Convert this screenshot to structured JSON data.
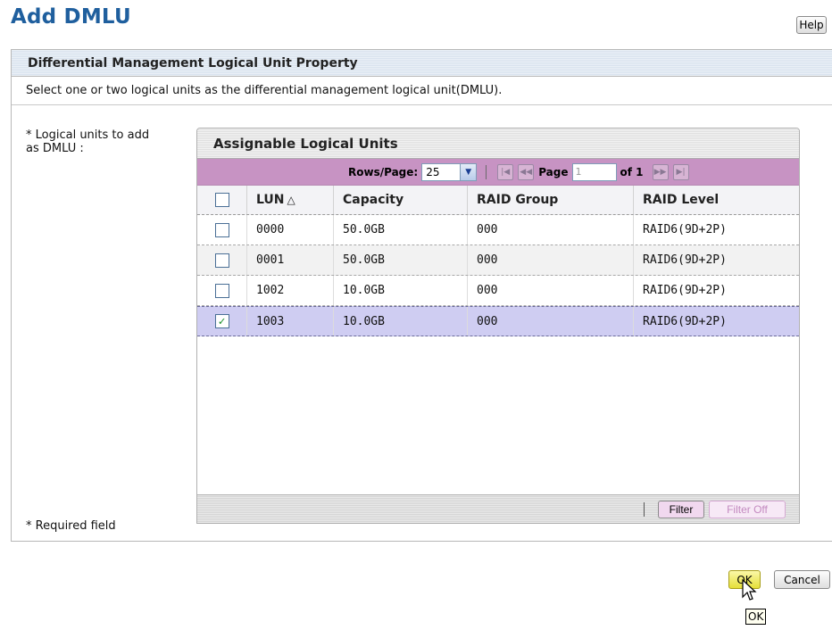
{
  "page": {
    "title": "Add DMLU",
    "help_label": "Help"
  },
  "panel": {
    "title": "Differential Management Logical Unit Property",
    "instructions": "Select one or two logical units as the differential management logical unit(DMLU).",
    "field_label_line1": "* Logical units to add",
    "field_label_line2": "as DMLU :",
    "required_note": "* Required field"
  },
  "grid": {
    "title": "Assignable Logical Units",
    "pager": {
      "rows_per_page_label": "Rows/Page:",
      "rows_per_page_value": "25",
      "page_label": "Page",
      "page_input_value": "1",
      "of_label": "of 1"
    },
    "columns": {
      "lun": "LUN",
      "lun_sort_glyph": "△",
      "capacity": "Capacity",
      "raid_group": "RAID Group",
      "raid_level": "RAID Level"
    },
    "rows": [
      {
        "lun": "0000",
        "capacity": "50.0GB",
        "raid_group": "000",
        "raid_level": "RAID6(9D+2P)",
        "checked": false
      },
      {
        "lun": "0001",
        "capacity": "50.0GB",
        "raid_group": "000",
        "raid_level": "RAID6(9D+2P)",
        "checked": false
      },
      {
        "lun": "1002",
        "capacity": "10.0GB",
        "raid_group": "000",
        "raid_level": "RAID6(9D+2P)",
        "checked": false
      },
      {
        "lun": "1003",
        "capacity": "10.0GB",
        "raid_group": "000",
        "raid_level": "RAID6(9D+2P)",
        "checked": true
      }
    ],
    "filter_label": "Filter",
    "filter_off_label": "Filter Off"
  },
  "actions": {
    "ok_label": "OK",
    "cancel_label": "Cancel",
    "tooltip": "OK"
  },
  "colors": {
    "title_blue": "#1f5f9e",
    "pager_purple": "#c793c3",
    "selected_row": "#cfcdf2",
    "ok_yellow": "#e5df39"
  },
  "icons": {
    "rows_dropdown": "chevron-down-icon",
    "first_page": "first-page-icon",
    "prev_page": "prev-page-icon",
    "next_page": "next-page-icon",
    "last_page": "last-page-icon",
    "cursor": "mouse-pointer-icon",
    "checkmark": "checkmark-icon",
    "sort": "sort-ascending-icon"
  }
}
